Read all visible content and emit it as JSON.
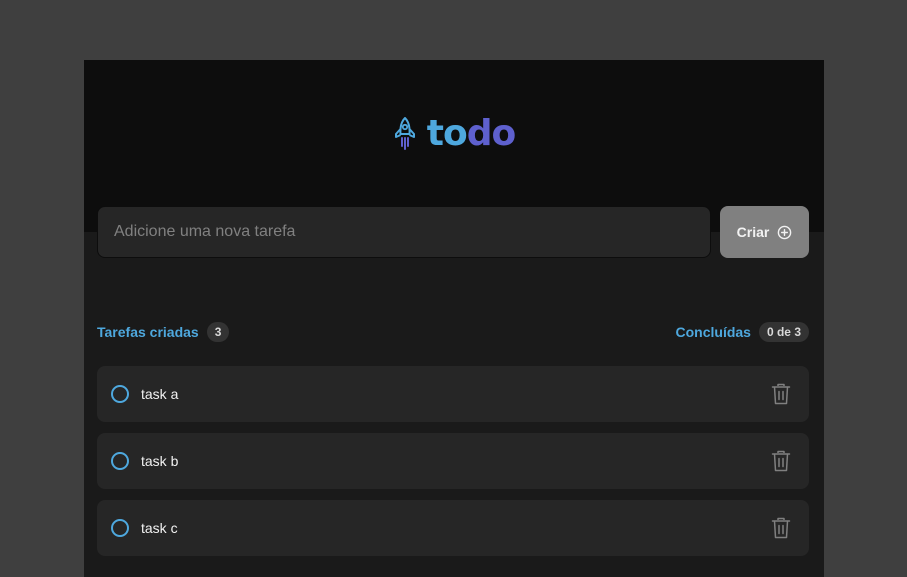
{
  "logo": {
    "icon": "rocket-icon",
    "text_part1": "to",
    "text_part2": "do",
    "colors": {
      "to": "#4ea8de",
      "do": "#5e60ce"
    }
  },
  "new_task": {
    "placeholder": "Adicione uma nova tarefa",
    "value": "",
    "create_label": "Criar",
    "create_icon": "plus-circle-icon"
  },
  "summary": {
    "created_label": "Tarefas criadas",
    "created_count": "3",
    "done_label": "Concluídas",
    "done_count": "0 de 3"
  },
  "tasks": [
    {
      "text": "task a",
      "done": false
    },
    {
      "text": "task b",
      "done": false
    },
    {
      "text": "task c",
      "done": false
    }
  ],
  "colors": {
    "background": "#3f3f3f",
    "header": "#0d0d0d",
    "panel": "#1a1a1a",
    "card": "#262626",
    "accent_blue": "#4ea8de",
    "accent_purple": "#5e60ce",
    "button_gray": "#808080"
  },
  "icons": {
    "task_delete": "trash-icon",
    "task_checkbox": "circle-outline"
  }
}
